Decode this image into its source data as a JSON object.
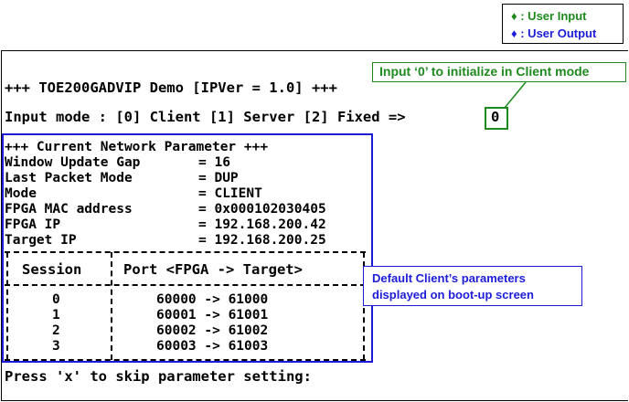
{
  "legend": {
    "user_input": "♦ : User Input",
    "user_output": "♦ : User Output"
  },
  "terminal": {
    "title": "+++ TOE200GADVIP Demo [IPVer = 1.0] +++",
    "prompt": "Input mode : [0] Client [1] Server [2] Fixed =>",
    "entered_value": "0",
    "params_header": "+++ Current Network Parameter +++",
    "params": [
      {
        "key": "Window Update Gap",
        "value": "= 16"
      },
      {
        "key": "Last Packet Mode",
        "value": "= DUP"
      },
      {
        "key": "Mode",
        "value": "= CLIENT"
      },
      {
        "key": "FPGA MAC address",
        "value": "= 0x000102030405"
      },
      {
        "key": "FPGA IP",
        "value": "= 192.168.200.42"
      },
      {
        "key": "Target IP",
        "value": "= 192.168.200.25"
      }
    ],
    "table": {
      "headers": [
        "Session",
        "Port <FPGA -> Target>"
      ],
      "rows": [
        {
          "session": "0",
          "port": "60000 -> 61000"
        },
        {
          "session": "1",
          "port": "60001 -> 61001"
        },
        {
          "session": "2",
          "port": "60002 -> 61002"
        },
        {
          "session": "3",
          "port": "60003 -> 61003"
        }
      ]
    },
    "footer": "Press 'x' to skip parameter setting:"
  },
  "callouts": {
    "client_mode": "Input ‘0’ to initialize in Client mode",
    "defaults_line1": "Default Client’s parameters",
    "defaults_line2": "displayed on boot-up screen"
  },
  "colors": {
    "user_input": "#1e8a1e",
    "user_output": "#1c1cd9"
  }
}
